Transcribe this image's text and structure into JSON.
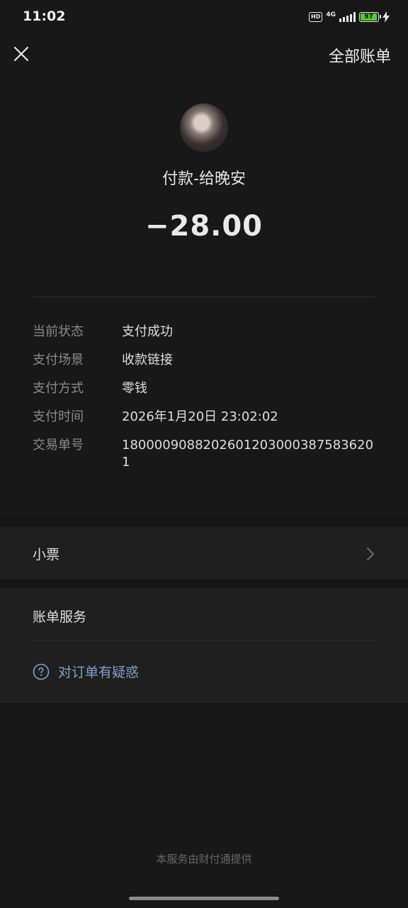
{
  "status_bar": {
    "time": "11:02",
    "hd": "HD",
    "network": "4G",
    "battery": "97",
    "battery_color": "#55c934"
  },
  "nav": {
    "close_icon": "close-icon",
    "all_bills_label": "全部账单"
  },
  "payment": {
    "payee_title": "付款-给晚安",
    "amount": "−28.00"
  },
  "details": [
    {
      "label": "当前状态",
      "value": "支付成功"
    },
    {
      "label": "支付场景",
      "value": "收款链接"
    },
    {
      "label": "支付方式",
      "value": "零钱"
    },
    {
      "label": "支付时间",
      "value": "2026年1月20日 23:02:02"
    },
    {
      "label": "交易单号",
      "value": "1800009088202601203000387583620 1"
    }
  ],
  "receipt": {
    "label": "小票",
    "icon": "chevron-right-icon"
  },
  "bill_services": {
    "title": "账单服务",
    "doubt_label": "对订单有疑惑",
    "doubt_icon": "question-circle-icon",
    "link_color": "#7fa0c8"
  },
  "footer": {
    "text": "本服务由财付通提供"
  }
}
